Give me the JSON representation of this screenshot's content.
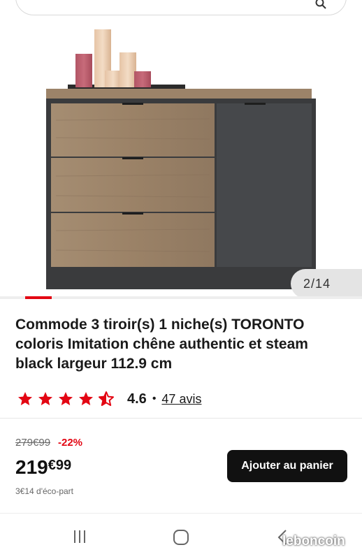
{
  "search": {
    "icon": "search-icon"
  },
  "product": {
    "image_counter": "2/14",
    "title": "Commode 3 tiroir(s) 1 niche(s) TORONTO coloris Imitation chêne authentic et steam black largeur 112.9 cm",
    "rating": {
      "score": "4.6",
      "separator": "•",
      "reviews": "47 avis",
      "stars_value": 4.5,
      "stars_max": 5
    }
  },
  "pricing": {
    "old_price": "279€99",
    "discount": "-22%",
    "price_main": "219",
    "price_cents": "€99",
    "eco_part": "3€14 d'éco-part",
    "add_to_cart_label": "Ajouter au panier"
  },
  "colors": {
    "accent": "#e30613",
    "button": "#111111"
  },
  "navbar": {
    "recents_icon": "recents-icon",
    "home_icon": "home-icon",
    "back_icon": "back-icon"
  },
  "watermark": {
    "text": "leboncoin"
  }
}
